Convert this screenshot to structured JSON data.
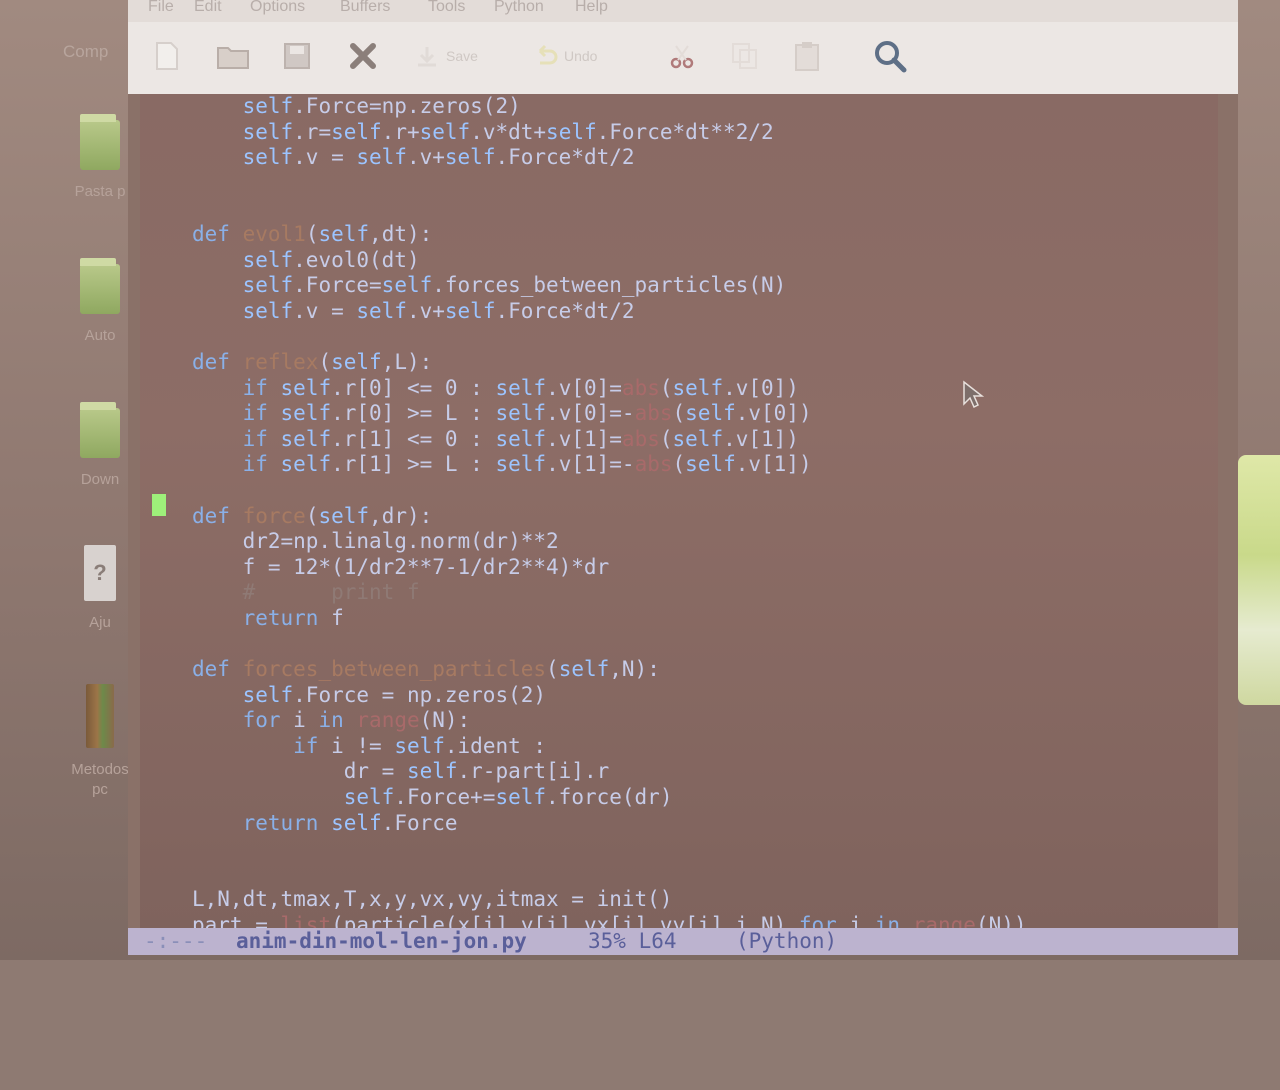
{
  "desktop": {
    "top_label": "Comp",
    "icons": [
      {
        "label": "Pasta p",
        "kind": "folder"
      },
      {
        "label": "Auto",
        "kind": "folder"
      },
      {
        "label": "Down",
        "kind": "folder"
      },
      {
        "label": "Aju",
        "kind": "doc",
        "glyph": "?"
      },
      {
        "label": "Metodos\npc",
        "kind": "book"
      }
    ]
  },
  "menubar": {
    "items": [
      "File",
      "Edit",
      "Options",
      "Buffers",
      "Tools",
      "Python",
      "Help"
    ]
  },
  "toolbar": {
    "buttons": [
      {
        "name": "new-file",
        "icon": "new-file-icon",
        "label": ""
      },
      {
        "name": "open-folder",
        "icon": "folder-icon",
        "label": ""
      },
      {
        "name": "save-disk",
        "icon": "disk-icon",
        "label": ""
      },
      {
        "name": "close",
        "icon": "close-icon",
        "label": ""
      },
      {
        "name": "save",
        "icon": "save-icon",
        "label": "Save"
      },
      {
        "name": "undo",
        "icon": "undo-icon",
        "label": "Undo"
      },
      {
        "name": "cut",
        "icon": "scissors-icon",
        "label": ""
      },
      {
        "name": "copy",
        "icon": "copy-icon",
        "label": ""
      },
      {
        "name": "paste",
        "icon": "paste-icon",
        "label": ""
      },
      {
        "name": "search",
        "icon": "search-icon",
        "label": ""
      }
    ]
  },
  "editor": {
    "lines": [
      "    self.Force=np.zeros(2)",
      "    self.r=self.r+self.v*dt+self.Force*dt**2/2",
      "    self.v = self.v+self.Force*dt/2",
      "",
      "",
      "def evol1(self,dt):",
      "    self.evol0(dt)",
      "    self.Force=self.forces_between_particles(N)",
      "    self.v = self.v+self.Force*dt/2",
      "",
      "def reflex(self,L):",
      "    if self.r[0] <= 0 : self.v[0]=abs(self.v[0])",
      "    if self.r[0] >= L : self.v[0]=-abs(self.v[0])",
      "    if self.r[1] <= 0 : self.v[1]=abs(self.v[1])",
      "    if self.r[1] >= L : self.v[1]=-abs(self.v[1])",
      "",
      "def force(self,dr):",
      "    dr2=np.linalg.norm(dr)**2",
      "    f = 12*(1/dr2**7-1/dr2**4)*dr",
      "    #      print f",
      "    return f",
      "",
      "def forces_between_particles(self,N):",
      "    self.Force = np.zeros(2)",
      "    for i in range(N):",
      "        if i != self.ident :",
      "            dr = self.r-part[i].r",
      "            self.Force+=self.force(dr)",
      "    return self.Force",
      "",
      "",
      "L,N,dt,tmax,T,x,y,vx,vy,itmax = init()",
      "part = list(particle(x[i],y[i],vx[i],vy[i],i,N) for i in range(N))"
    ]
  },
  "modeline": {
    "status": "-:---",
    "filename": "anim-din-mol-len-jon.py",
    "position": "35% L64",
    "mode": "(Python)"
  }
}
